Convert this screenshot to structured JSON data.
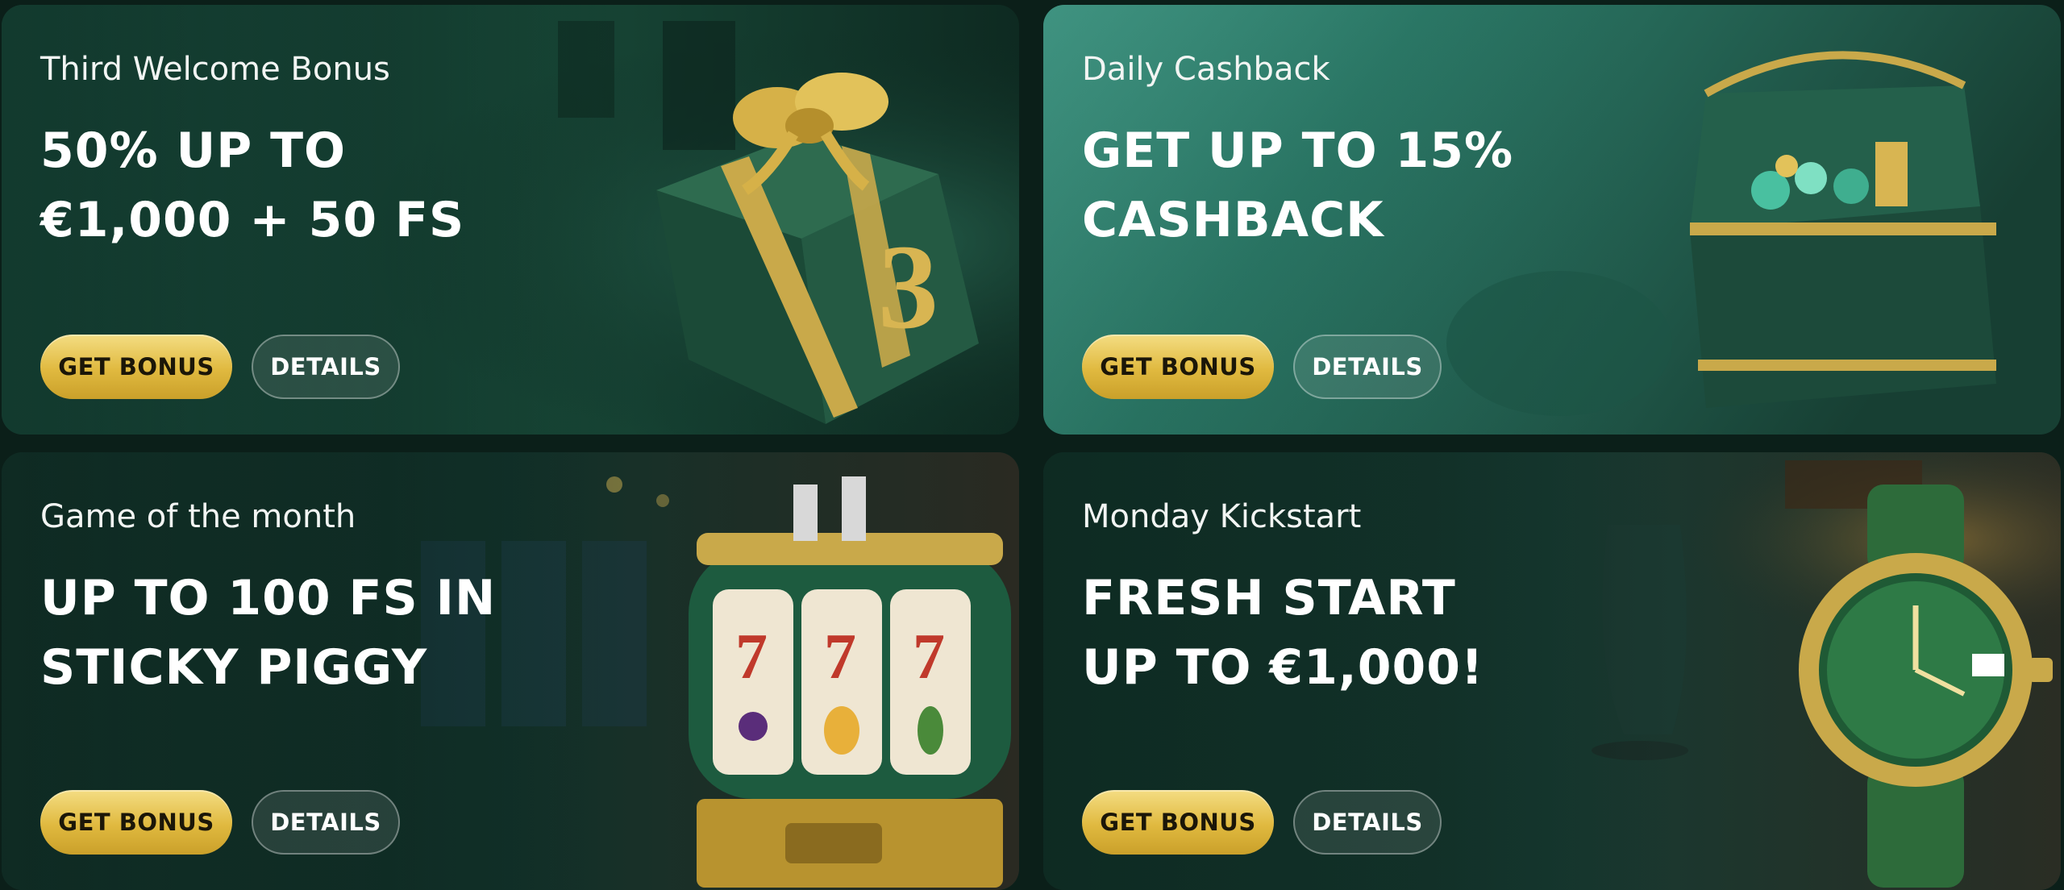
{
  "cards": [
    {
      "subtitle": "Third Welcome Bonus",
      "headline_line1": "50% UP TO",
      "headline_line2": "€1,000 + 50 FS",
      "primary_label": "GET BONUS",
      "secondary_label": "DETAILS",
      "art_number": "3",
      "art_icon": "gift-box-icon"
    },
    {
      "subtitle": "Daily Cashback",
      "headline_line1": "GET UP TO 15%",
      "headline_line2": "CASHBACK",
      "primary_label": "GET BONUS",
      "secondary_label": "DETAILS",
      "art_icon": "treasure-chest-icon"
    },
    {
      "subtitle": "Game of the month",
      "headline_line1": "UP TO 100 FS IN",
      "headline_line2": "STICKY PIGGY",
      "primary_label": "GET BONUS",
      "secondary_label": "DETAILS",
      "art_symbols": [
        "7",
        "7",
        "7"
      ],
      "art_icon": "slot-machine-icon"
    },
    {
      "subtitle": "Monday Kickstart",
      "headline_line1": "FRESH START",
      "headline_line2": "UP TO €1,000!",
      "primary_label": "GET BONUS",
      "secondary_label": "DETAILS",
      "art_icon": "wristwatch-icon"
    }
  ],
  "colors": {
    "card_green_dark": "#0f3a2e",
    "card_teal": "#2f7f6c",
    "gold": "#e0b93f",
    "text": "#ffffff"
  }
}
